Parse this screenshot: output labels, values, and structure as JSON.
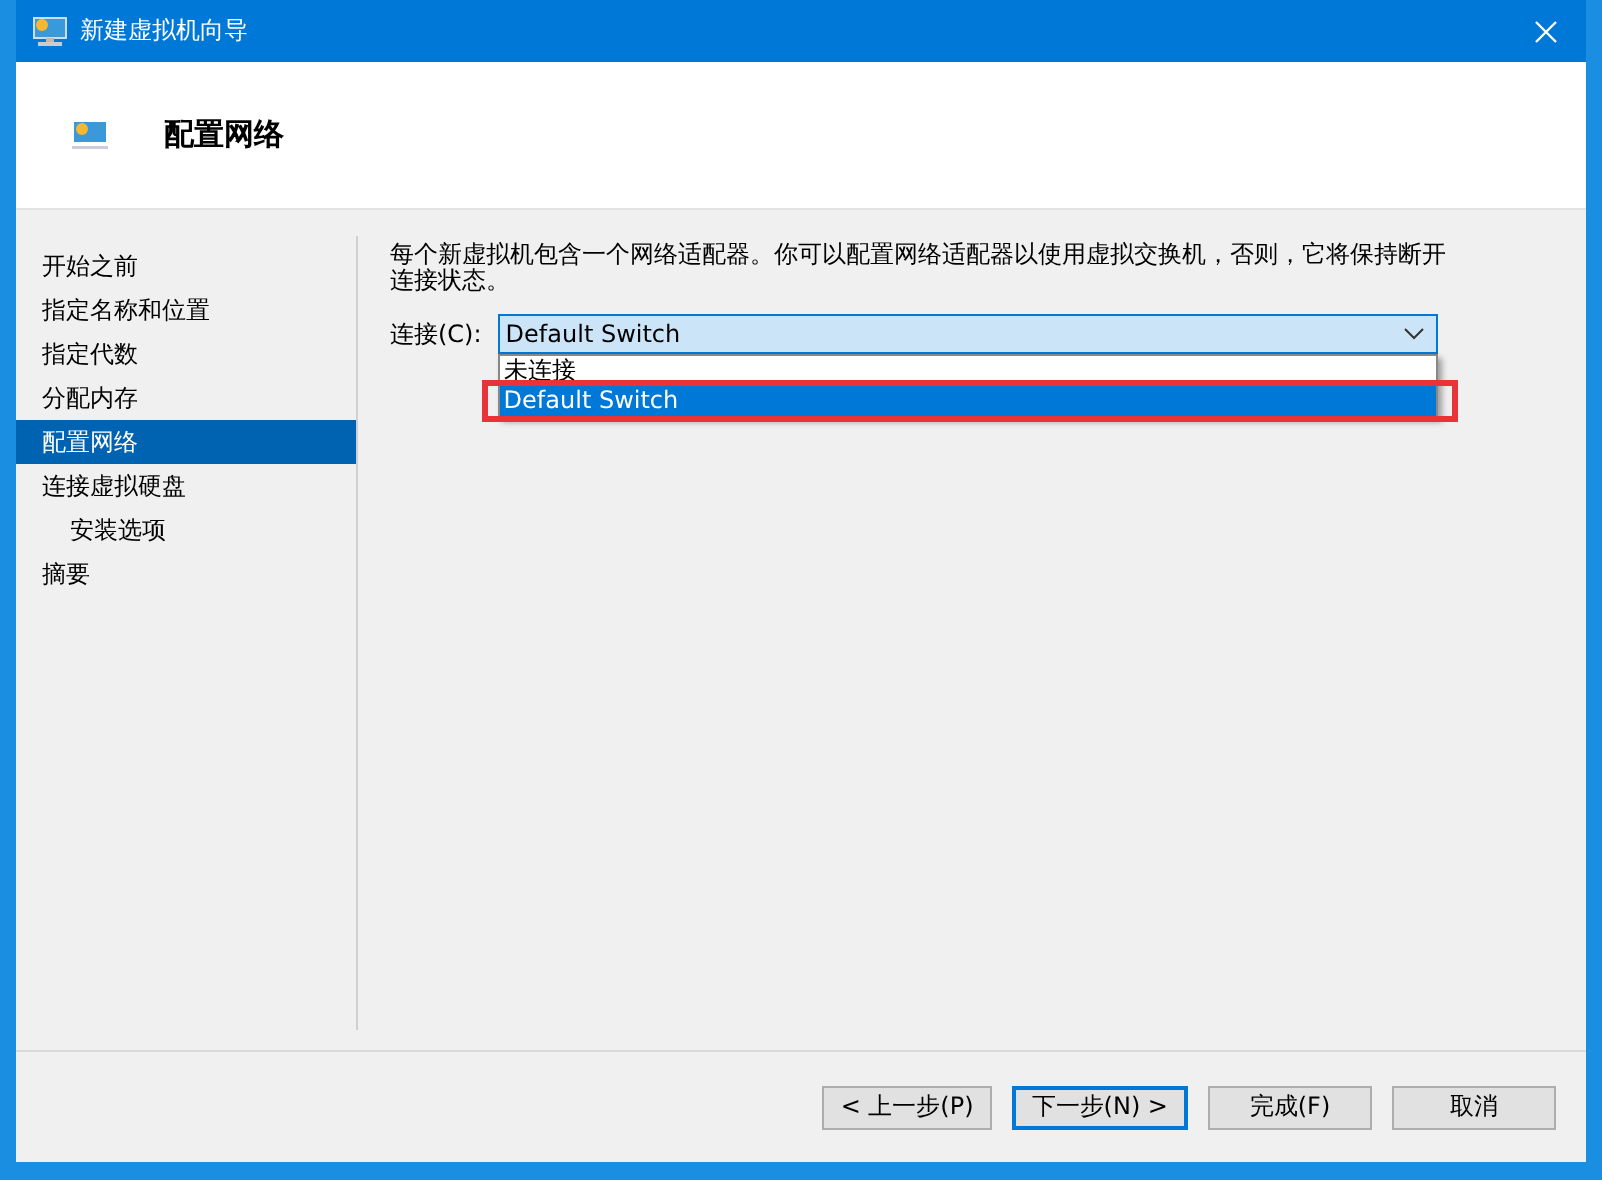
{
  "window": {
    "title": "新建虚拟机向导"
  },
  "header": {
    "title": "配置网络"
  },
  "sidebar": {
    "items": [
      {
        "label": "开始之前",
        "selected": false
      },
      {
        "label": "指定名称和位置",
        "selected": false
      },
      {
        "label": "指定代数",
        "selected": false
      },
      {
        "label": "分配内存",
        "selected": false
      },
      {
        "label": "配置网络",
        "selected": true
      },
      {
        "label": "连接虚拟硬盘",
        "selected": false,
        "children": [
          {
            "label": "安装选项",
            "selected": false
          }
        ]
      },
      {
        "label": "摘要",
        "selected": false
      }
    ]
  },
  "description": "每个新虚拟机包含一个网络适配器。你可以配置网络适配器以使用虚拟交换机，否则，它将保持断开连接状态。",
  "connection": {
    "label": "连接(C):",
    "value": "Default Switch",
    "expanded": true,
    "options": [
      {
        "label": "未连接",
        "selected": false,
        "highlighted": false
      },
      {
        "label": "Default Switch",
        "selected": true,
        "highlighted": true
      }
    ]
  },
  "buttons": [
    {
      "label": "< 上一步(P)",
      "default": false
    },
    {
      "label": "下一步(N) >",
      "default": true
    },
    {
      "label": "完成(F)",
      "default": false
    },
    {
      "label": "取消",
      "default": false
    }
  ]
}
